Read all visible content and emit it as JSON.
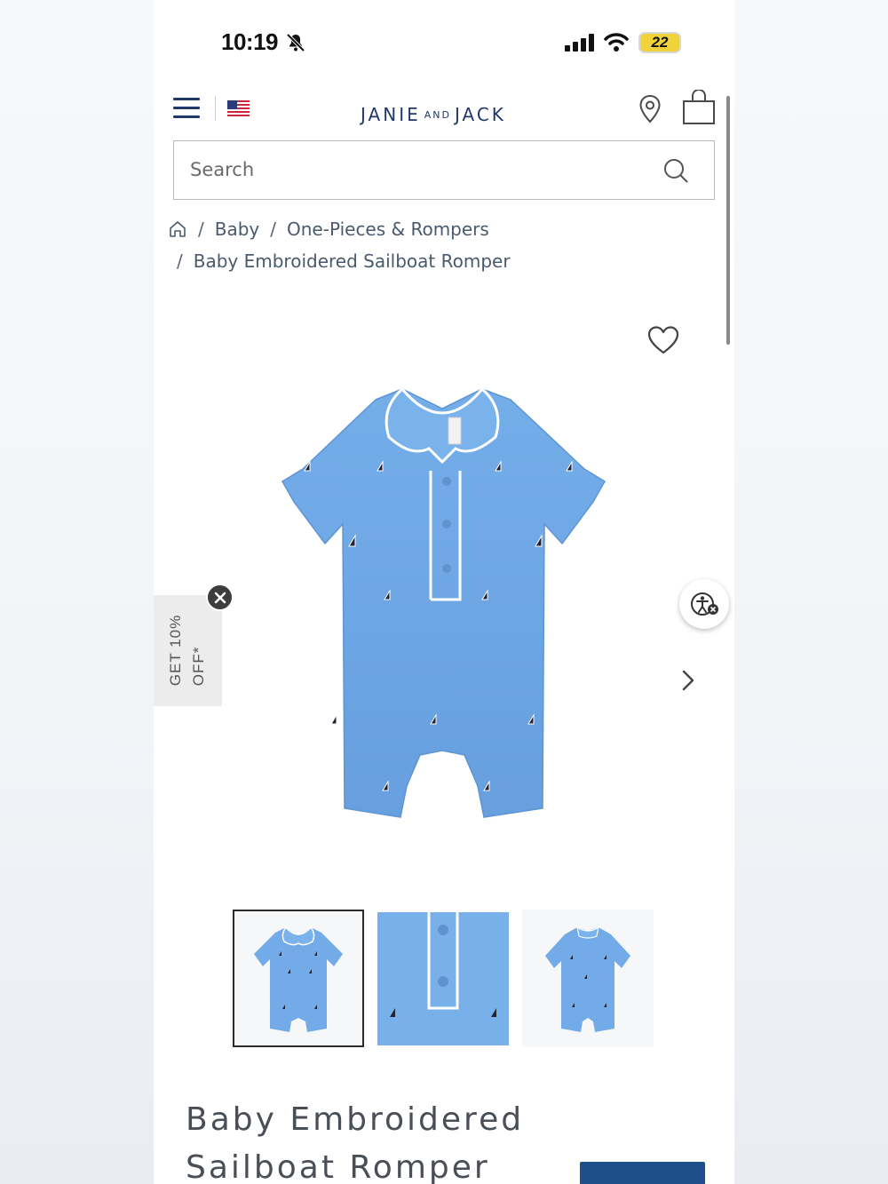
{
  "status_bar": {
    "time": "10:19",
    "battery": "22"
  },
  "header": {
    "logo_primary": "JANIE",
    "logo_and": "AND",
    "logo_secondary": "JACK"
  },
  "search": {
    "placeholder": "Search"
  },
  "breadcrumb": {
    "items": [
      "Baby",
      "One-Pieces & Rompers",
      "Baby Embroidered Sailboat Romper"
    ]
  },
  "promo": {
    "line1": "GET 10%",
    "line2": "OFF*"
  },
  "product": {
    "title": "Baby Embroidered Sailboat Romper",
    "color": "#6fa8e8",
    "thumbnails": [
      "front view",
      "detail view",
      "back view"
    ],
    "active_thumbnail": 0
  },
  "colors": {
    "brand_navy": "#1f3a6a",
    "cta_blue": "#1f4f8b"
  }
}
